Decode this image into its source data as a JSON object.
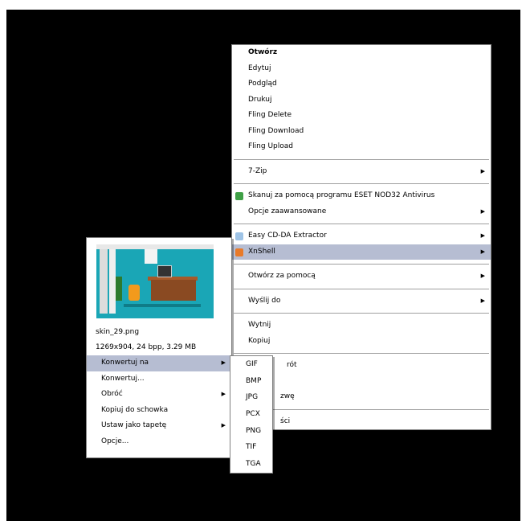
{
  "context_menu": {
    "items_top": [
      "Otwórz",
      "Edytuj",
      "Podgląd",
      "Drukuj",
      "Fling Delete",
      "Fling Download",
      "Fling Upload"
    ],
    "zip": "7-Zip",
    "eset_scan": "Skanuj za pomocą programu ESET NOD32 Antivirus",
    "advanced": "Opcje zaawansowane",
    "easy_cd": "Easy CD-DA Extractor",
    "xnshell": "XnShell",
    "open_with": "Otwórz za pomocą",
    "send_to": "Wyślij do",
    "cut": "Wytnij",
    "copy": "Kopiuj",
    "shortcut_partial": "rót",
    "rename_partial": "zwę",
    "properties_partial": "ści",
    "submenu_arrow": "▶",
    "colors": {
      "highlight": "#b6bdd2",
      "eset_icon": "#3fa046",
      "easy_cd_icon": "#9ec3e6",
      "xnshell_icon": "#e87a2a"
    }
  },
  "xnshell_panel": {
    "filename": "skin_29.png",
    "details": "1269x904, 24 bpp, 3.29 MB",
    "items": [
      {
        "label": "Konwertuj na",
        "submenu": true,
        "highlighted": true
      },
      {
        "label": "Konwertuj...",
        "submenu": false
      },
      {
        "label": "Obróć",
        "submenu": true
      },
      {
        "label": "Kopiuj do schowka",
        "submenu": false
      },
      {
        "label": "Ustaw jako tapetę",
        "submenu": true
      },
      {
        "label": "Opcje...",
        "submenu": false
      }
    ]
  },
  "format_menu": {
    "items": [
      "GIF",
      "BMP",
      "JPG",
      "PCX",
      "PNG",
      "TIF",
      "TGA"
    ]
  }
}
